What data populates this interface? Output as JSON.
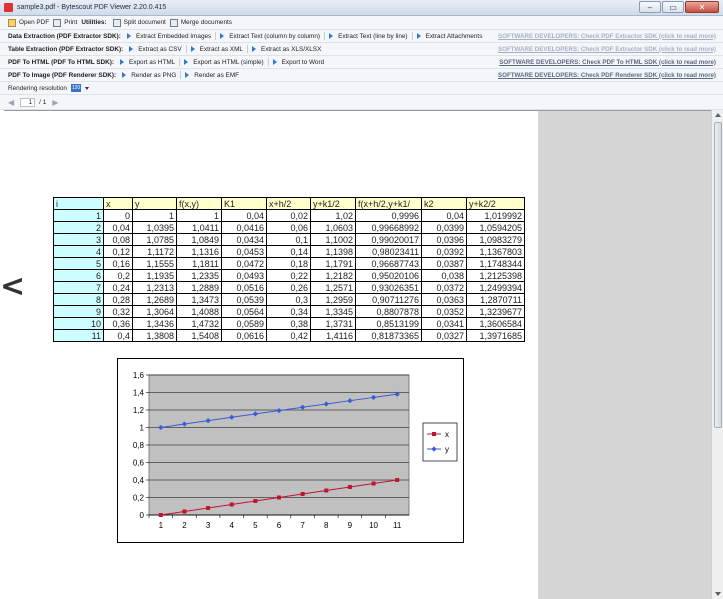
{
  "window": {
    "title": "sample3.pdf - Bytescout PDF Viewer 2.20.0.415",
    "controls": [
      "–",
      "▭",
      "✕"
    ]
  },
  "toolbar1": {
    "open_label": "Open PDF",
    "print_label": "Print",
    "utilities_label": "Utilities:",
    "split_label": "Split document",
    "merge_label": "Merge documents"
  },
  "toolbar2": {
    "label": "Data Extraction (PDF Extractor SDK):",
    "items": [
      "Extract Embedded Images",
      "Extract Text (column by column)",
      "Extract Text (line by line)",
      "Extract Attachments"
    ],
    "promo": "SOFTWARE DEVELOPERS: Check PDF Extractor SDK (click to read more)"
  },
  "toolbar3": {
    "label": "Table Extraction (PDF Extractor SDK):",
    "items": [
      "Extract as CSV",
      "Extract as XML",
      "Extract as XLS/XLSX"
    ],
    "promo": "SOFTWARE DEVELOPERS: Check PDF Extractor SDK (click to read more)"
  },
  "toolbar4": {
    "label": "PDF To HTML (PDF To HTML SDK):",
    "items": [
      "Export as HTML",
      "Export as HTML (simple)",
      "Export to Word"
    ],
    "promo": "SOFTWARE DEVELOPERS: Check PDF To HTML SDK (click to read more)"
  },
  "toolbar5": {
    "label": "PDF To Image (PDF Renderer SDK):",
    "items": [
      "Render as PNG",
      "Render as EMF"
    ],
    "promo": "SOFTWARE DEVELOPERS: Check PDF Renderer SDK (click to read more)"
  },
  "resolution": {
    "label": "Rendering resolution",
    "value": "120"
  },
  "pagenav": {
    "current": "1",
    "total": "/ 1"
  },
  "table": {
    "headers": [
      "i",
      "x",
      "y",
      "f(x,y)",
      "K1",
      "x+h/2",
      "y+k1/2",
      "f(x+h/2,y+k1/",
      "k2",
      "y+k2/2"
    ],
    "rows": [
      [
        "1",
        "0",
        "1",
        "1",
        "0,04",
        "0,02",
        "1,02",
        "0,9996",
        "0,04",
        "1,019992"
      ],
      [
        "2",
        "0,04",
        "1,0395",
        "1,0411",
        "0,0416",
        "0,06",
        "1,0603",
        "0,99668992",
        "0,0399",
        "1,0594205"
      ],
      [
        "3",
        "0,08",
        "1,0785",
        "1,0849",
        "0,0434",
        "0,1",
        "1,1002",
        "0,99020017",
        "0,0396",
        "1,0983279"
      ],
      [
        "4",
        "0,12",
        "1,1172",
        "1,1316",
        "0,0453",
        "0,14",
        "1,1398",
        "0,98023411",
        "0,0392",
        "1,1367803"
      ],
      [
        "5",
        "0,16",
        "1,1555",
        "1,1811",
        "0,0472",
        "0,18",
        "1,1791",
        "0,96687743",
        "0,0387",
        "1,1748344"
      ],
      [
        "6",
        "0,2",
        "1,1935",
        "1,2335",
        "0,0493",
        "0,22",
        "1,2182",
        "0,95020106",
        "0,038",
        "1,2125398"
      ],
      [
        "7",
        "0,24",
        "1,2313",
        "1,2889",
        "0,0516",
        "0,26",
        "1,2571",
        "0,93026351",
        "0,0372",
        "1,2499394"
      ],
      [
        "8",
        "0,28",
        "1,2689",
        "1,3473",
        "0,0539",
        "0,3",
        "1,2959",
        "0,90711276",
        "0,0363",
        "1,2870711"
      ],
      [
        "9",
        "0,32",
        "1,3064",
        "1,4088",
        "0,0564",
        "0,34",
        "1,3345",
        "0,8807878",
        "0,0352",
        "1,3239677"
      ],
      [
        "10",
        "0,36",
        "1,3436",
        "1,4732",
        "0,0589",
        "0,38",
        "1,3731",
        "0,8513199",
        "0,0341",
        "1,3606584"
      ],
      [
        "11",
        "0,4",
        "1,3808",
        "1,5408",
        "0,0616",
        "0,42",
        "1,4116",
        "0,81873365",
        "0,0327",
        "1,3971685"
      ]
    ]
  },
  "chart_data": {
    "type": "line",
    "categories": [
      1,
      2,
      3,
      4,
      5,
      6,
      7,
      8,
      9,
      10,
      11
    ],
    "ylim": [
      0,
      1.6
    ],
    "yticks": [
      "0",
      "0,2",
      "0,4",
      "0,6",
      "0,8",
      "1",
      "1,2",
      "1,4",
      "1,6"
    ],
    "grid": true,
    "legend": "right",
    "series": [
      {
        "name": "x",
        "color": "#c0142f",
        "marker": "square",
        "values": [
          0,
          0.04,
          0.08,
          0.12,
          0.16,
          0.2,
          0.24,
          0.28,
          0.32,
          0.36,
          0.4
        ]
      },
      {
        "name": "y",
        "color": "#3a5bd6",
        "marker": "diamond",
        "values": [
          1,
          1.0395,
          1.0785,
          1.1172,
          1.1555,
          1.1935,
          1.2313,
          1.2689,
          1.3064,
          1.3436,
          1.3808
        ]
      }
    ]
  },
  "colors": {
    "promo_text": "#a3b0c3",
    "accent": "#2f78d4",
    "plot_area": "#c0c0c0"
  }
}
